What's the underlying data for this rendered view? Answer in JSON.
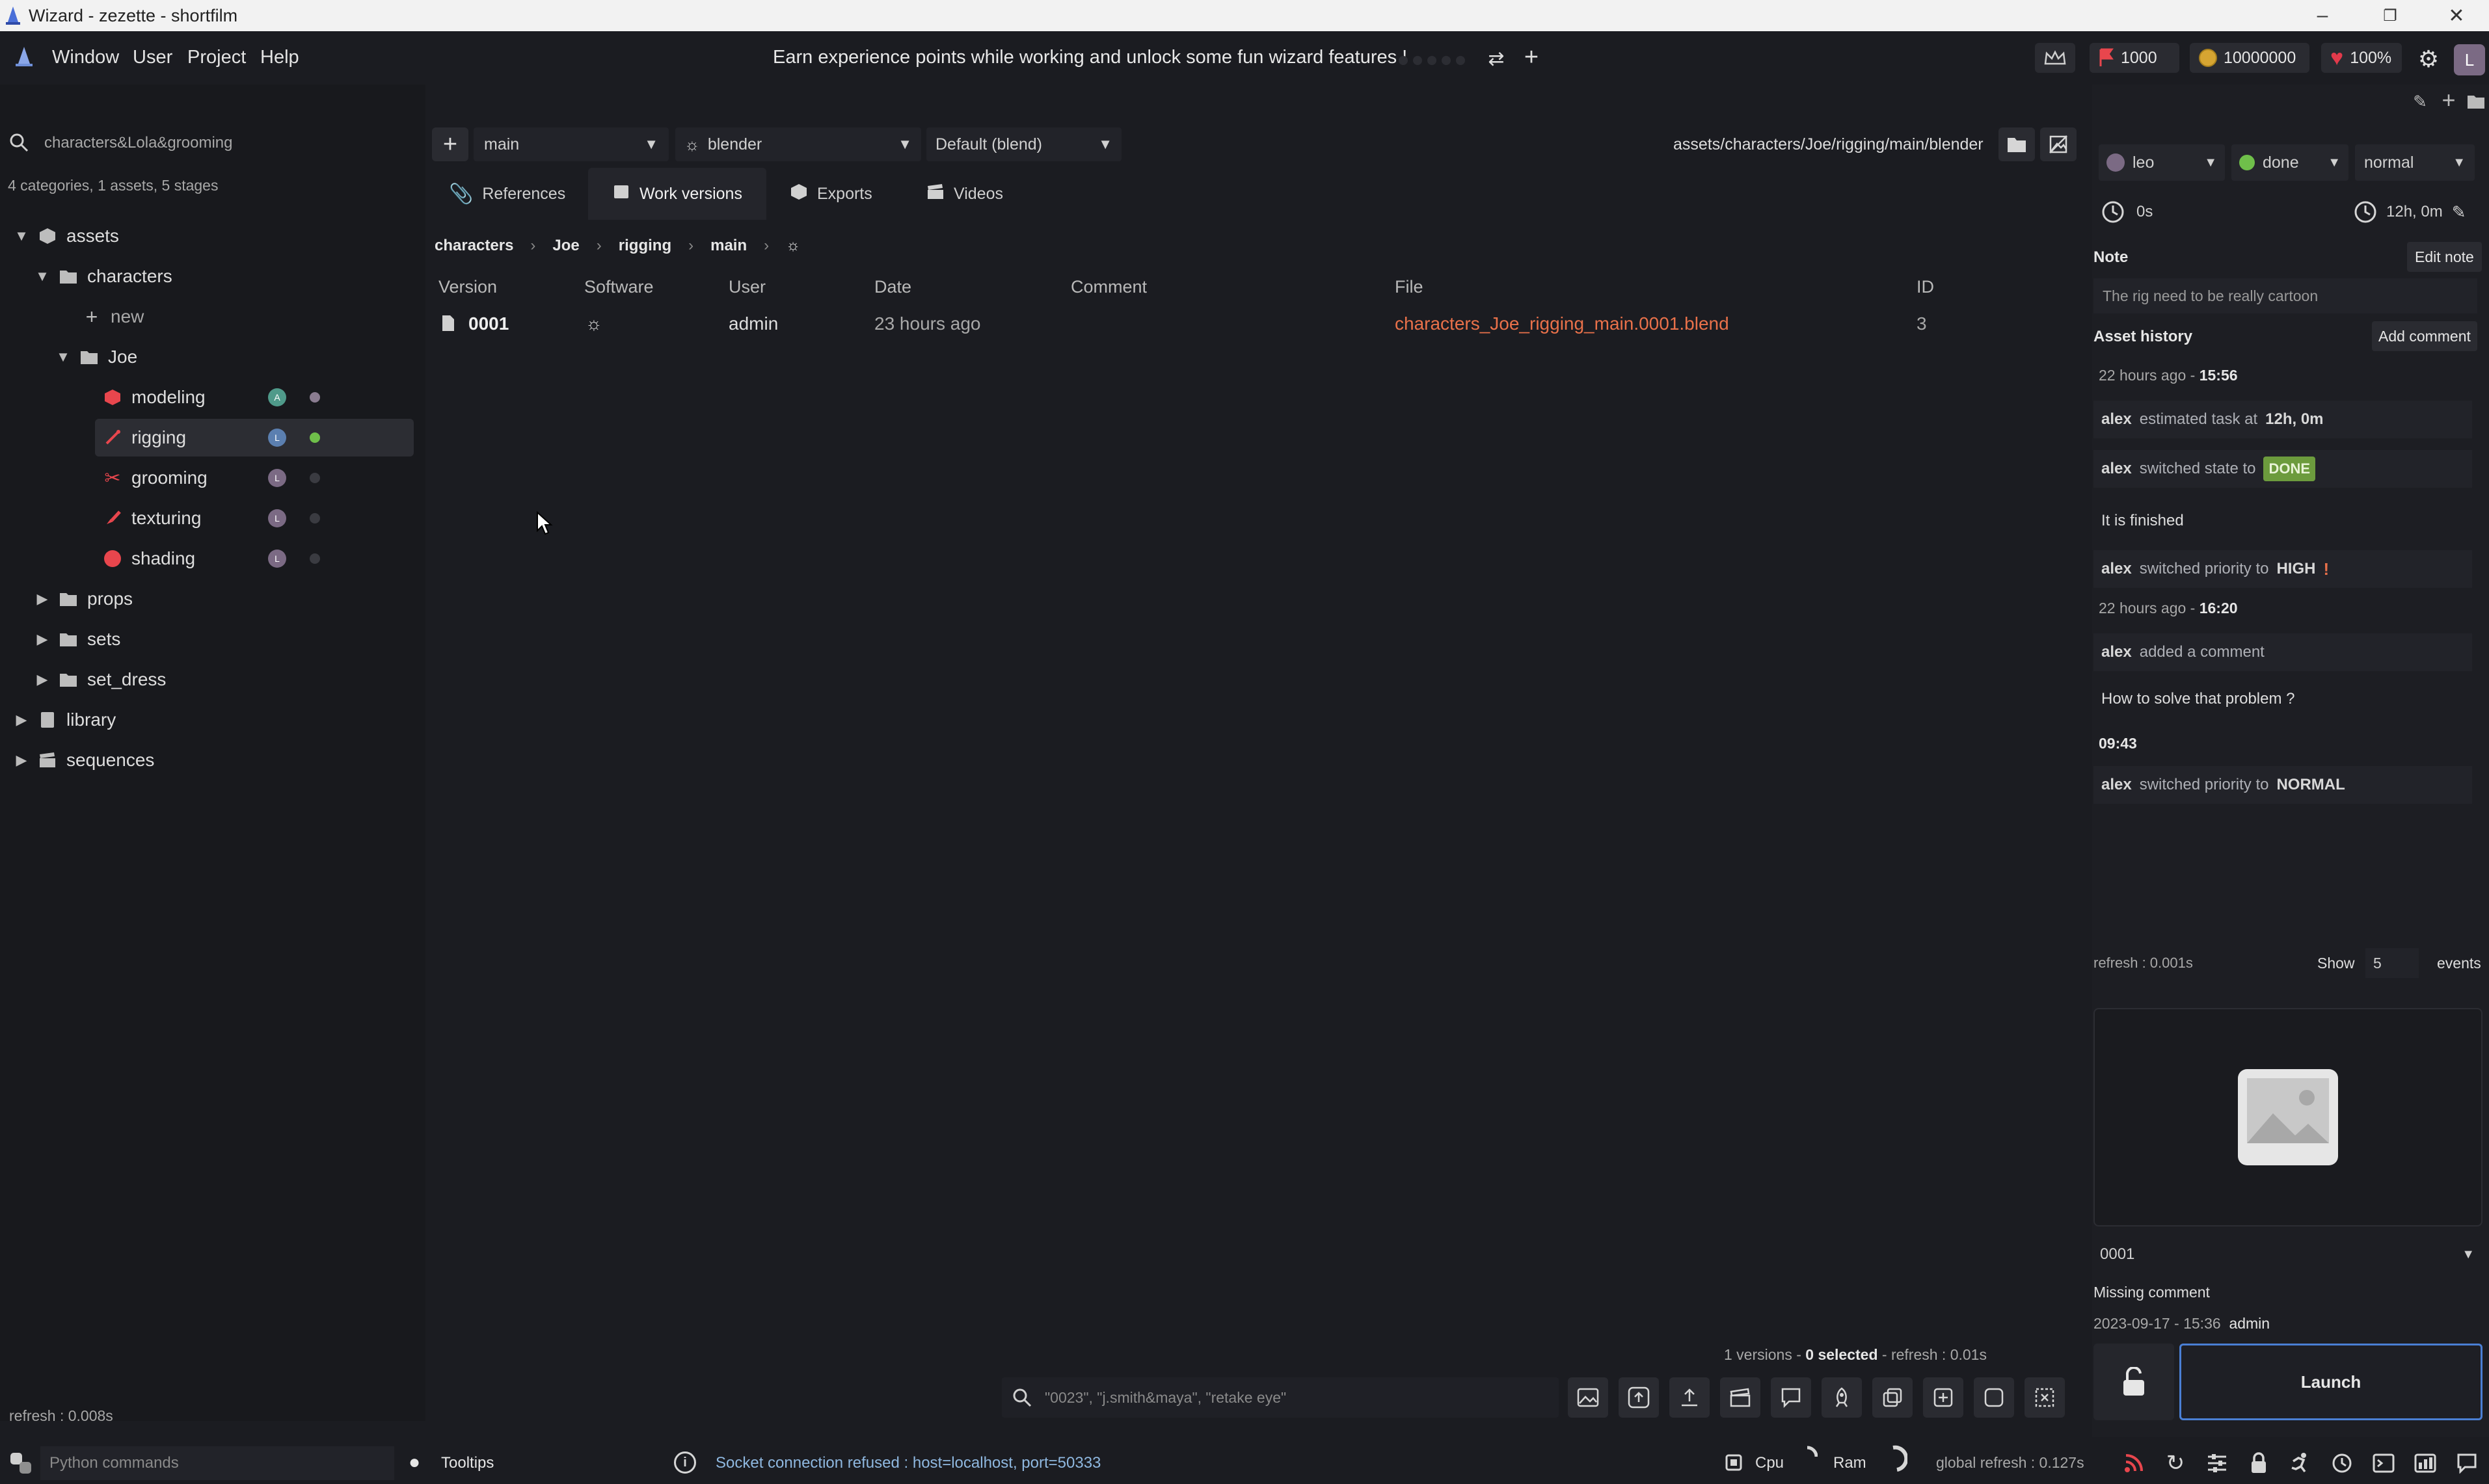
{
  "window": {
    "title": "Wizard - zezette - shortfilm",
    "controls": [
      "minimize",
      "restore",
      "close"
    ]
  },
  "menu": {
    "items": [
      "Window",
      "User",
      "Project",
      "Help"
    ],
    "xp_message": "Earn experience points while working and unlock some fun wizard features !",
    "coins_1": "1000",
    "coins_2": "10000000",
    "life": "100%",
    "user_initial": "L"
  },
  "search": {
    "value": "characters&Lola&grooming",
    "summary": "4 categories, 1 assets, 5 stages"
  },
  "tree": {
    "assets": "assets",
    "characters": "characters",
    "new": "new",
    "joe": "Joe",
    "stages": [
      {
        "label": "modeling",
        "avatar": "A",
        "avatar_color": "#4f9a8a",
        "dot": "#8a7c90"
      },
      {
        "label": "rigging",
        "avatar": "L",
        "avatar_color": "#5b7fb0",
        "dot": "#6fbf4a"
      },
      {
        "label": "grooming",
        "avatar": "L",
        "avatar_color": "#7b6a84",
        "dot": "#3a3b41"
      },
      {
        "label": "texturing",
        "avatar": "L",
        "avatar_color": "#7b6a84",
        "dot": "#3a3b41"
      },
      {
        "label": "shading",
        "avatar": "L",
        "avatar_color": "#7b6a84",
        "dot": "#3a3b41"
      }
    ],
    "props": "props",
    "sets": "sets",
    "set_dress": "set_dress",
    "library": "library",
    "sequences": "sequences",
    "refresh": "refresh : 0.008s"
  },
  "toolbar": {
    "variant": "main",
    "software": "blender",
    "extension": "Default (blend)",
    "path": "assets/characters/Joe/rigging/main/blender"
  },
  "tabs": [
    "References",
    "Work versions",
    "Exports",
    "Videos"
  ],
  "breadcrumb": [
    "characters",
    "Joe",
    "rigging",
    "main"
  ],
  "table": {
    "headers": [
      "Version",
      "Software",
      "User",
      "Date",
      "Comment",
      "File",
      "ID"
    ],
    "rows": [
      {
        "version": "0001",
        "user": "admin",
        "date": "23 hours ago",
        "comment": "",
        "file": "characters_Joe_rigging_main.0001.blend",
        "id": "3"
      }
    ]
  },
  "footer": {
    "count_prefix": "1 versions - ",
    "selected": "0 selected",
    "refresh": " - refresh : 0.01s",
    "search_placeholder": "\"0023\", \"j.smith&maya\", \"retake eye\""
  },
  "right": {
    "user": "leo",
    "state": "done",
    "priority": "normal",
    "time_spent": "0s",
    "estimated": "12h, 0m",
    "note_label": "Note",
    "edit_note": "Edit note",
    "note_text": "The rig need to be really cartoon",
    "history_label": "Asset history",
    "add_comment": "Add comment",
    "history": {
      "day1": "22 hours ago - ",
      "day1_time": "15:56",
      "e1_user": "alex",
      "e1_text": "estimated task at",
      "e1_value": "12h, 0m",
      "e2_user": "alex",
      "e2_text": "switched state to",
      "e2_value": "DONE",
      "e2_comment": "It is finished",
      "e3_user": "alex",
      "e3_text": "switched priority to",
      "e3_value": "HIGH",
      "day2": "22 hours ago - ",
      "day2_time": "16:20",
      "e4_user": "alex",
      "e4_text": "added a comment",
      "e4_comment": "How to solve that problem ?",
      "day3_time": "09:43",
      "e5_user": "alex",
      "e5_text": "switched priority to",
      "e5_value": "NORMAL"
    },
    "refresh": "refresh : 0.001s",
    "show_label": "Show",
    "show_value": "5",
    "events_label": "events",
    "version_select": "0001",
    "missing_comment": "Missing comment",
    "version_date": "2023-09-17 - 15:36",
    "version_user": "admin",
    "launch": "Launch"
  },
  "status": {
    "python_placeholder": "Python commands",
    "tooltips": "Tooltips",
    "message": "Socket connection refused : host=localhost, port=50333",
    "cpu": "Cpu",
    "ram": "Ram",
    "global_refresh": "global refresh : 0.127s"
  },
  "colors": {
    "accent_file": "#e9714a",
    "done": "#6c9b3d",
    "info_text": "#8fb8e0",
    "launch_border": "#4a7fd4",
    "flag": "#e8464d",
    "heart": "#e23a4b",
    "coin": "#d6a532"
  }
}
